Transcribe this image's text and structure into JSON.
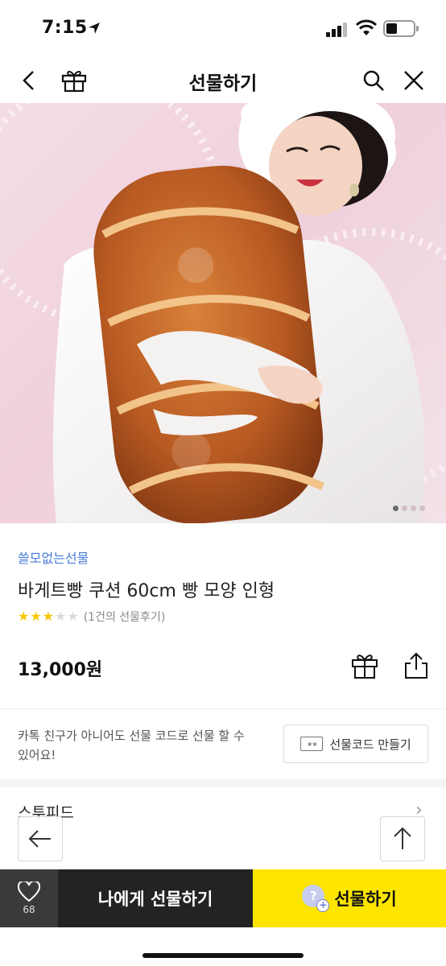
{
  "status_bar": {
    "time": "7:15"
  },
  "header": {
    "title": "선물하기"
  },
  "hero": {
    "slide_count": 4,
    "active_index": 0
  },
  "product": {
    "brand": "쓸모없는선물",
    "name": "바게트빵 쿠션 60cm 빵 모양 인형",
    "rating": 3,
    "rating_max": 5,
    "review_text": "(1건의 선물후기)",
    "price": "13,000원"
  },
  "notice": {
    "text": "카톡 친구가 아니어도 선물 코드로 선물 할 수 있어요!",
    "code_button_label": "선물코드 만들기"
  },
  "brand_row": {
    "label": "스투피드"
  },
  "bottom_bar": {
    "wish_count": "68",
    "self_gift_label": "나에게 선물하기",
    "gift_label": "선물하기"
  },
  "colors": {
    "accent_yellow": "#fee500",
    "brand_blue": "#4a7cd6",
    "dark": "#232323"
  },
  "icons": [
    "back-icon",
    "gift-icon",
    "search-icon",
    "close-icon",
    "share-icon",
    "heart-icon",
    "arrow-left-icon",
    "arrow-up-icon",
    "ticket-icon",
    "friend-plus-icon"
  ]
}
